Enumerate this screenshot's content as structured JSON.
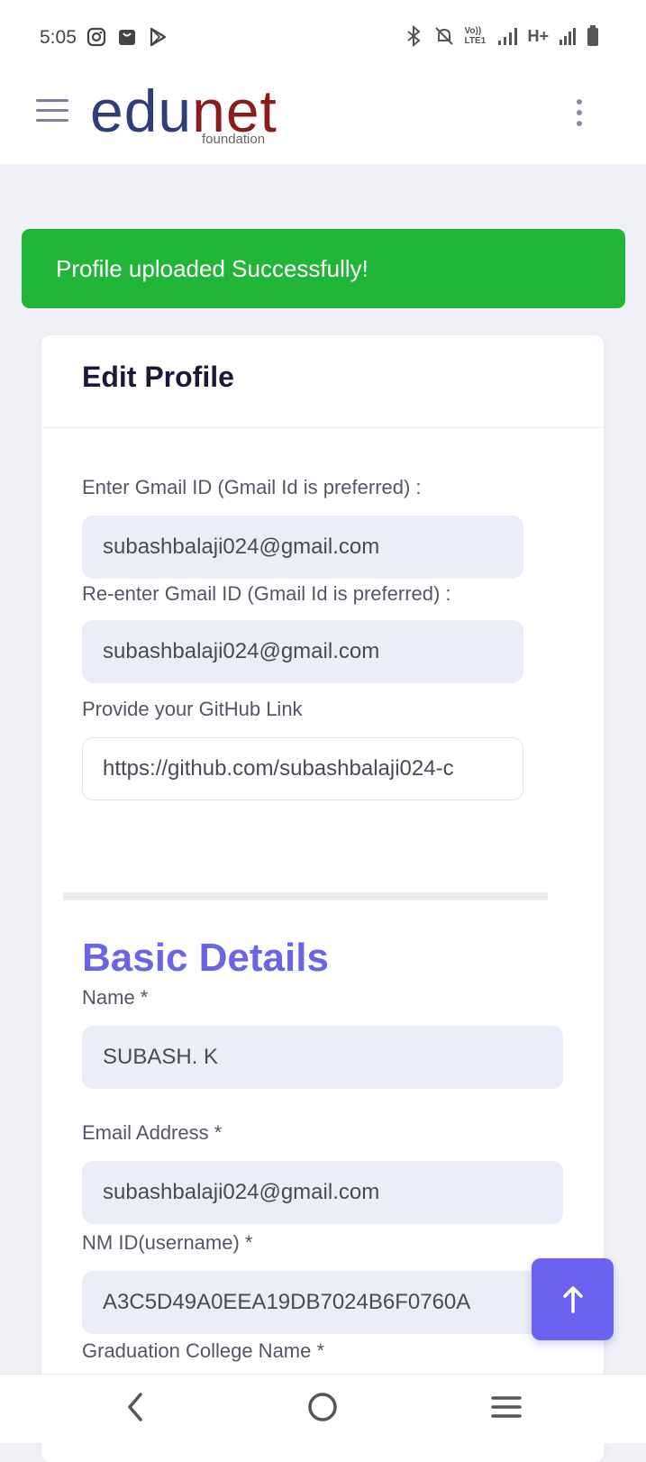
{
  "status_bar": {
    "time": "5:05",
    "left_icons": [
      "instagram-icon",
      "shopping-bag-icon",
      "play-store-icon"
    ],
    "right_icons": [
      "bluetooth-icon",
      "bell-off-icon",
      "volte-icon",
      "signal-icon",
      "h-plus-icon",
      "signal-icon",
      "battery-icon"
    ],
    "network_label": "H+",
    "volte_label": "Vo)) LTE1"
  },
  "header": {
    "logo_edu": "edu",
    "logo_net": "net",
    "logo_sub": "foundation",
    "menu_icon": "hamburger-icon",
    "more_icon": "kebab-menu-icon"
  },
  "alert": {
    "message": "Profile uploaded Successfully!",
    "color": "#21b637"
  },
  "card": {
    "title": "Edit Profile",
    "fields": {
      "gmail_label": "Enter Gmail ID (Gmail Id is preferred) :",
      "gmail_value": "subashbalaji024@gmail.com",
      "regmail_label": "Re-enter Gmail ID (Gmail Id is preferred) :",
      "regmail_value": "subashbalaji024@gmail.com",
      "github_label": "Provide your GitHub Link",
      "github_value": "https://github.com/subashbalaji024-c"
    },
    "basic": {
      "title": "Basic Details",
      "name_label": "Name *",
      "name_value": "SUBASH. K",
      "email_label": "Email Address *",
      "email_value": "subashbalaji024@gmail.com",
      "nmid_label": "NM ID(username) *",
      "nmid_value": "A3C5D49A0EEA19DB7024B6F0760A",
      "college_label": "Graduation College Name *"
    }
  },
  "fab": {
    "icon": "arrow-up-icon",
    "color": "#6b63f0"
  },
  "nav": {
    "back_icon": "back-icon",
    "home_icon": "home-icon",
    "recents_icon": "recents-icon"
  }
}
